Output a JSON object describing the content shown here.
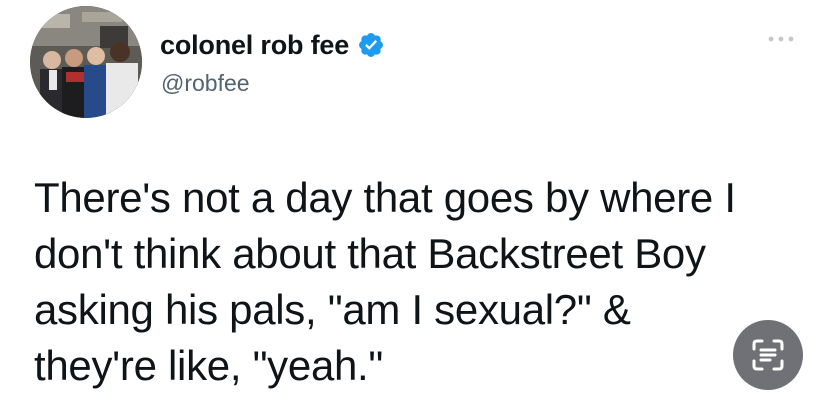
{
  "tweet": {
    "author": {
      "display_name": "colonel rob fee",
      "handle": "@robfee",
      "verified": true,
      "verified_color": "#1d9bf0"
    },
    "text_lines": [
      "There's not a day that goes by where I",
      "don't think about that Backstreet Boy",
      "asking his pals, \"am I sexual?\" &",
      "they're like, \"yeah.\""
    ]
  },
  "icons": {
    "more": "more-dots-icon",
    "verified": "verified-badge-icon",
    "scan": "live-text-scan-icon"
  },
  "colors": {
    "text": "#0f1419",
    "handle": "#536471",
    "scan_button": "#6f7176"
  }
}
